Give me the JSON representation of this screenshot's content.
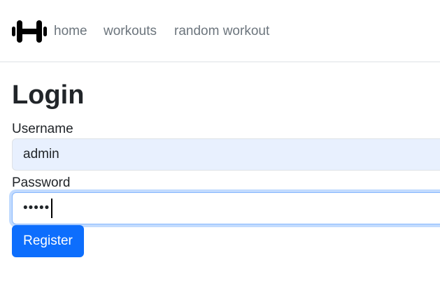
{
  "nav": {
    "logo_icon": "dumbbell-icon",
    "links": [
      "home",
      "workouts",
      "random workout"
    ]
  },
  "form": {
    "title": "Login",
    "username_label": "Username",
    "username_value": "admin",
    "password_label": "Password",
    "password_value": "admin",
    "submit_label": "Register"
  },
  "colors": {
    "primary": "#0d6efd",
    "autofill_bg": "#e8f0fe",
    "nav_link": "#6c757d"
  }
}
